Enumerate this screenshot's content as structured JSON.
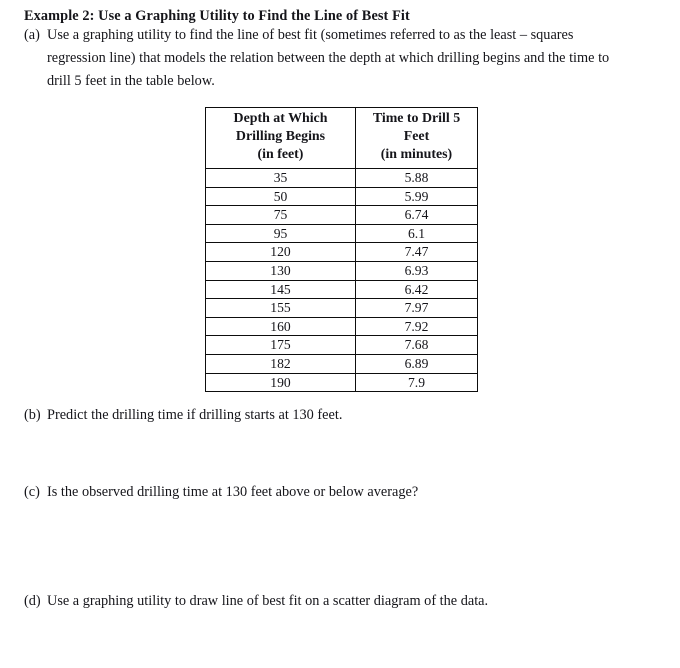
{
  "document": {
    "title": "Example 2: Use a Graphing Utility to Find the Line of Best Fit",
    "items": [
      {
        "marker": "(a)",
        "text": "Use a graphing utility to find the line of best fit (sometimes referred to as the least – squares regression line) that models the relation between the depth at which drilling begins and the time to drill 5 feet in the table below."
      },
      {
        "marker": "(b)",
        "text": "Predict the drilling time if drilling starts at 130 feet."
      },
      {
        "marker": "(c)",
        "text": "Is the observed drilling time at 130 feet above or below average?"
      },
      {
        "marker": "(d)",
        "text": "Use a graphing utility to draw line of best fit on a scatter diagram of the data."
      }
    ]
  },
  "table": {
    "headers": [
      {
        "lines": [
          "Depth at Which",
          "Drilling Begins",
          "(in feet)"
        ]
      },
      {
        "lines": [
          "Time to Drill 5",
          "Feet",
          "(in minutes)"
        ]
      }
    ],
    "rows": [
      [
        "35",
        "5.88"
      ],
      [
        "50",
        "5.99"
      ],
      [
        "75",
        "6.74"
      ],
      [
        "95",
        "6.1"
      ],
      [
        "120",
        "7.47"
      ],
      [
        "130",
        "6.93"
      ],
      [
        "145",
        "6.42"
      ],
      [
        "155",
        "7.97"
      ],
      [
        "160",
        "7.92"
      ],
      [
        "175",
        "7.68"
      ],
      [
        "182",
        "6.89"
      ],
      [
        "190",
        "7.9"
      ]
    ]
  },
  "chart_data": {
    "type": "table",
    "title": "Depth at Which Drilling Begins vs. Time to Drill 5 Feet",
    "xlabel": "Depth at Which Drilling Begins (in feet)",
    "ylabel": "Time to Drill 5 Feet (in minutes)",
    "x": [
      35,
      50,
      75,
      95,
      120,
      130,
      145,
      155,
      160,
      175,
      182,
      190
    ],
    "y": [
      5.88,
      5.99,
      6.74,
      6.1,
      7.47,
      6.93,
      6.42,
      7.97,
      7.92,
      7.68,
      6.89,
      7.9
    ],
    "series": [
      {
        "name": "Time to Drill 5 Feet (in minutes)",
        "values": [
          5.88,
          5.99,
          6.74,
          6.1,
          7.47,
          6.93,
          6.42,
          7.97,
          7.92,
          7.68,
          6.89,
          7.9
        ]
      }
    ],
    "categories": [
      "35",
      "50",
      "75",
      "95",
      "120",
      "130",
      "145",
      "155",
      "160",
      "175",
      "182",
      "190"
    ],
    "grid": true,
    "legend": "none"
  },
  "colors": {
    "text": "#15151a",
    "border": "#0d0d0d",
    "background": "#ffffff"
  }
}
